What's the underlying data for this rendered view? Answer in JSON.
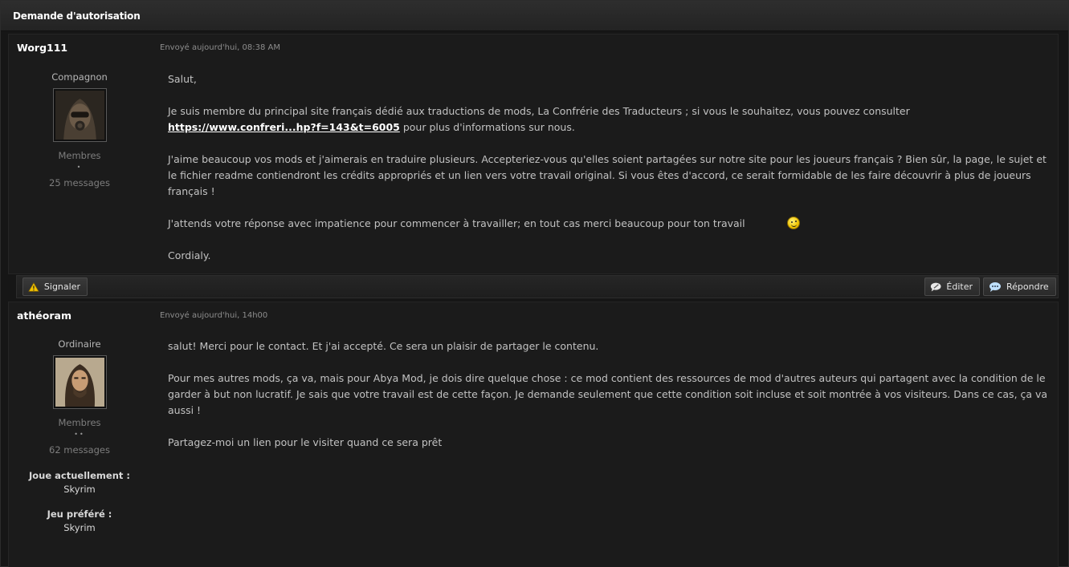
{
  "thread": {
    "title": "Demande d'autorisation"
  },
  "posts": [
    {
      "author": "Worg111",
      "date": "Envoyé aujourd'hui, 08:38 AM",
      "rank": "Compagnon",
      "group": "Membres",
      "pips": "•",
      "messages": "25 messages",
      "body": {
        "greeting": "Salut,",
        "p1_text": "Je suis membre du principal site français dédié aux traductions de mods, La Confrérie des Traducteurs ; si vous le souhaitez, vous pouvez consulter",
        "p1_link": "https://www.confreri...hp?f=143&t=6005",
        "p1_after": " pour plus d'informations sur nous.",
        "p2": "J'aime beaucoup vos mods et j'aimerais en traduire plusieurs. Accepteriez-vous qu'elles soient partagées sur notre site pour les joueurs français ? Bien sûr, la page, le sujet et le fichier readme contiendront les crédits appropriés et un lien vers votre travail original. Si vous êtes d'accord, ce serait formidable de les faire découvrir à plus de joueurs français !",
        "p3": "J'attends votre réponse avec impatience pour commencer à travailler; en tout cas merci beaucoup pour ton travail",
        "p4": "Cordialy."
      }
    },
    {
      "author": "athéoram",
      "date": "Envoyé aujourd'hui, 14h00",
      "rank": "Ordinaire",
      "group": "Membres",
      "pips": "••",
      "messages": "62 messages",
      "playing_label": "Joue actuellement :",
      "playing_value": "Skyrim",
      "favorite_label": "Jeu préféré :",
      "favorite_value": "Skyrim",
      "body": {
        "p1": "salut! Merci pour le contact. Et j'ai accepté. Ce sera un plaisir de partager le contenu.",
        "p2": "Pour mes autres mods, ça va, mais pour Abya Mod, je dois dire quelque chose : ce mod contient des ressources de mod d'autres auteurs qui partagent avec la condition de le garder à but non lucratif. Je sais que votre travail est de cette façon. Je demande seulement que cette condition soit incluse et soit montrée à vos visiteurs. Dans ce cas, ça va aussi !",
        "p3": "Partagez-moi un lien pour le visiter quand ce sera prêt"
      }
    }
  ],
  "actions": {
    "report_label": "Signaler",
    "edit_label": "Éditer",
    "reply_label": "Répondre"
  },
  "icons": {
    "report": "warning-icon",
    "edit": "edit-bubble-icon",
    "reply": "reply-bubble-icon",
    "smiley": "wink-smiley-icon"
  },
  "colors": {
    "background": "#161616",
    "post_bg": "#1b1b1b",
    "link": "#ffffff",
    "text": "#c2c2c2"
  }
}
